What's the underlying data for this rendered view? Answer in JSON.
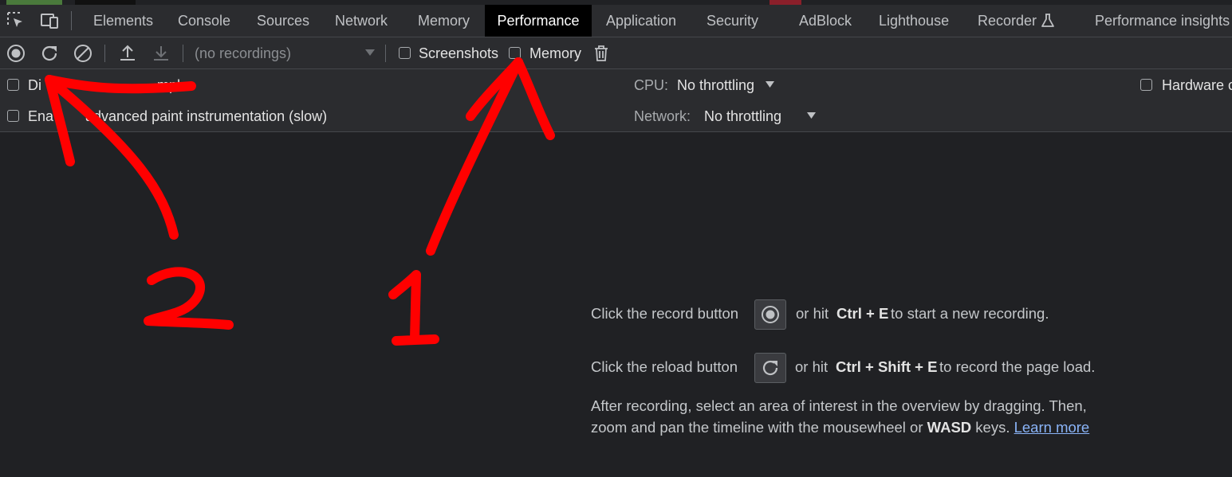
{
  "tabs": [
    {
      "label": "Elements"
    },
    {
      "label": "Console"
    },
    {
      "label": "Sources"
    },
    {
      "label": "Network"
    },
    {
      "label": "Memory"
    },
    {
      "label": "Performance",
      "active": true
    },
    {
      "label": "Application"
    },
    {
      "label": "Security"
    },
    {
      "label": "AdBlock"
    },
    {
      "label": "Lighthouse"
    },
    {
      "label": "Recorder"
    },
    {
      "label": "Performance insights"
    }
  ],
  "toolbar": {
    "recordings_placeholder": "(no recordings)",
    "screenshots_label": "Screenshots",
    "memory_label": "Memory"
  },
  "settings": {
    "disable_js_samples": "Disable JavaScript samples",
    "disable_js_samples_visible_start": "Di",
    "disable_js_samples_visible_end": "mples",
    "enable_paint": "Enable advanced paint instrumentation (slow)",
    "enable_paint_visible_start": "Ena",
    "enable_paint_visible_end": "advanced paint instrumentation (slow)",
    "cpu_label": "CPU:",
    "cpu_value": "No throttling",
    "network_label": "Network:",
    "network_value": "No throttling",
    "hardware_label": "Hardware c"
  },
  "landing": {
    "record_pre": "Click the record button",
    "record_mid": "or hit",
    "record_key": "Ctrl + E",
    "record_post": "to start a new recording.",
    "reload_pre": "Click the reload button",
    "reload_mid": "or hit",
    "reload_key": "Ctrl + Shift + E",
    "reload_post": "to record the page load.",
    "after_line1": "After recording, select an area of interest in the overview by dragging. Then,",
    "after_line2_pre": "zoom and pan the timeline with the mousewheel or",
    "after_line2_key": "WASD",
    "after_line2_post": "keys.",
    "learn_more": "Learn more"
  },
  "annotations": {
    "number_1": "1",
    "number_2": "2",
    "color": "#ff0000"
  }
}
